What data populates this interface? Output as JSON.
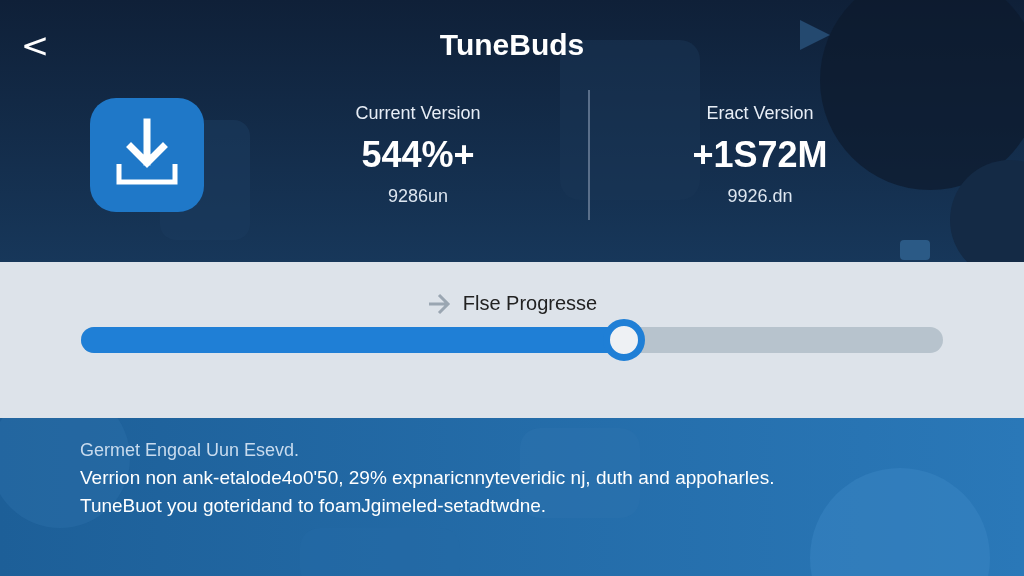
{
  "header": {
    "back": "<",
    "title": "TuneBuds"
  },
  "versions": [
    {
      "label": "Current Version",
      "value": "544%+",
      "sub": "9286un"
    },
    {
      "label": "Eract Version",
      "value": "+1S72M",
      "sub": "9926.dn"
    }
  ],
  "progress": {
    "label": "Flse Progresse",
    "level": 0.63
  },
  "notes": {
    "heading": "Germet Engoal Uun Esevd.",
    "lines": [
      "Verrion non ank-etalode4o0'50, 29% expnaricnnyteveridic nj, duth and appoharles.",
      "TuneBuot you goteridand to foamJgimeled-setadtwdne."
    ]
  }
}
